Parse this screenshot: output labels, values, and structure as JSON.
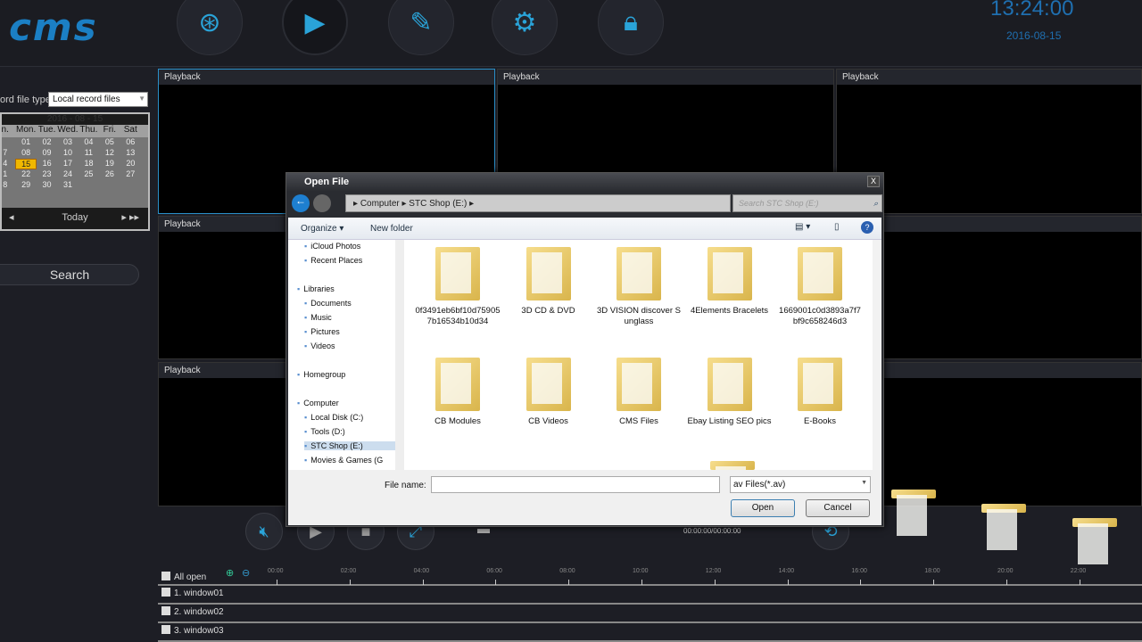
{
  "topbar": {
    "logo": "cms",
    "clock": "13:24:00",
    "date": "2016-08-15",
    "buttons": [
      {
        "name": "search-video",
        "icon": "film-search-icon"
      },
      {
        "name": "playback",
        "icon": "play-icon"
      },
      {
        "name": "log",
        "icon": "edit-icon"
      },
      {
        "name": "settings",
        "icon": "gear-icon"
      },
      {
        "name": "lock",
        "icon": "lock-icon"
      }
    ]
  },
  "left": {
    "file_type_label": "ord file type",
    "file_type_value": "Local record files",
    "calendar": {
      "header": "2016 - 08 - 15",
      "days": [
        "n.",
        "Mon.",
        "Tue.",
        "Wed.",
        "Thu.",
        "Fri.",
        "Sat"
      ],
      "rows": [
        [
          "",
          "01",
          "02",
          "03",
          "04",
          "05",
          "06"
        ],
        [
          "7",
          "08",
          "09",
          "10",
          "11",
          "12",
          "13"
        ],
        [
          "4",
          "15",
          "16",
          "17",
          "18",
          "19",
          "20"
        ],
        [
          "1",
          "22",
          "23",
          "24",
          "25",
          "26",
          "27"
        ],
        [
          "8",
          "29",
          "30",
          "31",
          "",
          "",
          ""
        ]
      ],
      "selected": "15",
      "today": "Today"
    },
    "search": "Search"
  },
  "grid": {
    "cell_label": "Playback"
  },
  "dialog": {
    "title": "Open File",
    "close": "X",
    "path": [
      "Computer",
      "STC Shop (E:)"
    ],
    "search_placeholder": "Search STC Shop (E:)",
    "organize": "Organize ▾",
    "new_folder": "New folder",
    "tree": [
      "iCloud Photos",
      "Recent Places",
      "Libraries",
      "Documents",
      "Music",
      "Pictures",
      "Videos",
      "Homegroup",
      "Computer",
      "Local Disk (C:)",
      "Tools (D:)",
      "STC Shop (E:)",
      "Movies & Games (G"
    ],
    "files": [
      "0f3491eb6bf10d759057b16534b10d34",
      "3D CD & DVD",
      "3D VISION discover Sunglass",
      "4Elements Bracelets",
      "1669001c0d3893a7f7bf9c658246d3",
      "CB Modules",
      "CB Videos",
      "CMS Files",
      "Ebay Listing SEO pics",
      "E-Books"
    ],
    "file_name_label": "File name:",
    "file_name_value": "",
    "filter": "av Files(*.av)",
    "open": "Open",
    "cancel": "Cancel"
  },
  "player": {
    "time": "00:00:00/00:00:00"
  },
  "timeline": {
    "all_open": "All open",
    "ticks": [
      "00:00",
      "02:00",
      "04:00",
      "06:00",
      "08:00",
      "10:00",
      "12:00",
      "14:00",
      "16:00",
      "18:00",
      "20:00",
      "22:00"
    ],
    "windows": [
      "1. window01",
      "2. window02",
      "3. window03"
    ]
  }
}
